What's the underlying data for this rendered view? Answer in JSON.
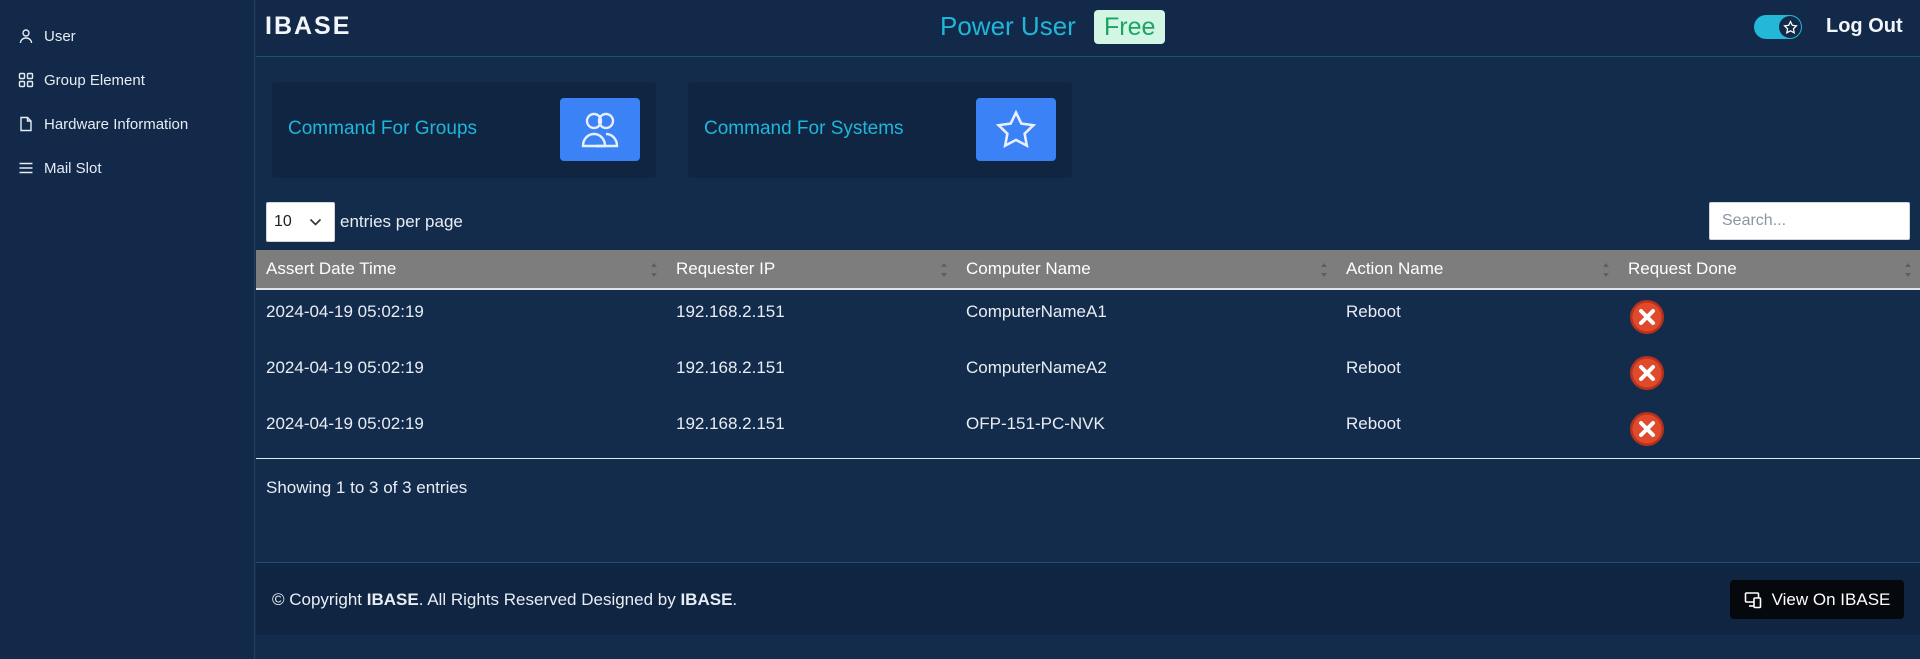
{
  "sidebar": {
    "items": [
      {
        "label": "User",
        "icon": "user-icon"
      },
      {
        "label": "Group Element",
        "icon": "grid-icon"
      },
      {
        "label": "Hardware Information",
        "icon": "document-icon"
      },
      {
        "label": "Mail Slot",
        "icon": "menu-icon"
      }
    ]
  },
  "header": {
    "brand": "IBASE",
    "role": "Power User",
    "plan": "Free",
    "logout": "Log Out"
  },
  "cards": [
    {
      "title": "Command For Groups",
      "icon": "users-icon"
    },
    {
      "title": "Command For Systems",
      "icon": "star-icon"
    }
  ],
  "controls": {
    "entries_value": "10",
    "entries_label": "entries per page",
    "search_placeholder": "Search..."
  },
  "table": {
    "columns": [
      "Assert Date Time",
      "Requester IP",
      "Computer Name",
      "Action Name",
      "Request Done"
    ],
    "rows": [
      {
        "date": "2024-04-19 05:02:19",
        "ip": "192.168.2.151",
        "computer": "ComputerNameA1",
        "action": "Reboot"
      },
      {
        "date": "2024-04-19 05:02:19",
        "ip": "192.168.2.151",
        "computer": "ComputerNameA2",
        "action": "Reboot"
      },
      {
        "date": "2024-04-19 05:02:19",
        "ip": "192.168.2.151",
        "computer": "OFP-151-PC-NVK",
        "action": "Reboot"
      }
    ],
    "showing": "Showing 1 to 3 of 3 entries"
  },
  "footer": {
    "prefix": "© Copyright ",
    "brand1": "IBASE",
    "middle": ". All Rights Reserved Designed by ",
    "brand2": "IBASE",
    "suffix": ".",
    "view_button": "View On IBASE"
  },
  "colors": {
    "accent": "#1fb6d9",
    "badge_bg": "#d3f5e4",
    "badge_text": "#1aa564",
    "icon_button": "#3b82f6",
    "header_row": "#7d7d7d",
    "background": "#142c4c"
  }
}
